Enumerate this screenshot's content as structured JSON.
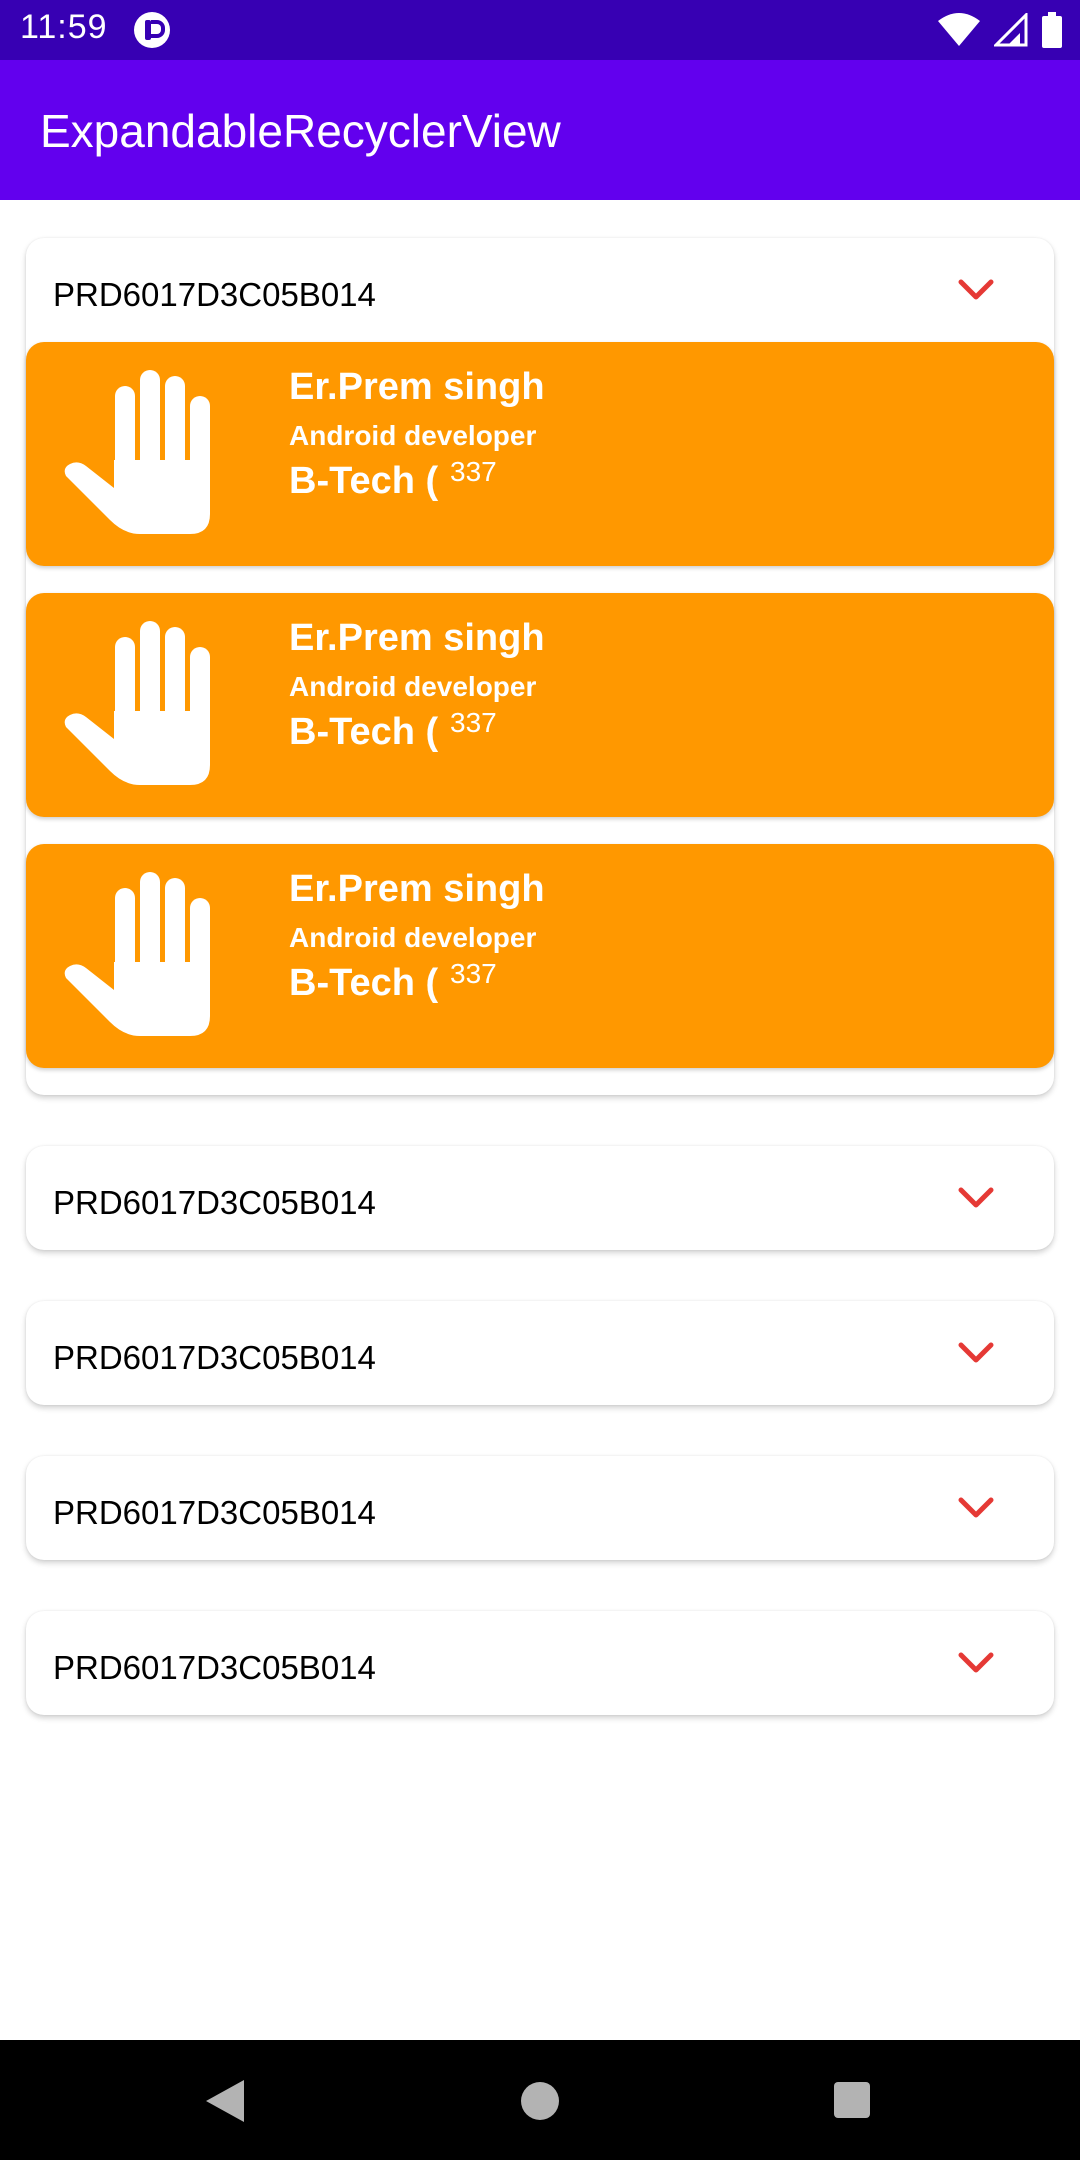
{
  "status_bar": {
    "time": "11:59",
    "icons": [
      "app-notification-icon",
      "wifi-icon",
      "signal-icon",
      "battery-icon"
    ]
  },
  "app_bar": {
    "title": "ExpandableRecyclerView"
  },
  "colors": {
    "status_bar": "#3700B3",
    "app_bar": "#6200EE",
    "child_card": "#FF9800",
    "chevron": "#E53935"
  },
  "groups": [
    {
      "title": "PRD6017D3C05B014",
      "expanded": true,
      "children": [
        {
          "icon": "hand-icon",
          "name": "Er.Prem singh",
          "role": "Android developer",
          "degree": "B-Tech (",
          "degree_sup": "337"
        },
        {
          "icon": "hand-icon",
          "name": "Er.Prem singh",
          "role": "Android developer",
          "degree": "B-Tech (",
          "degree_sup": "337"
        },
        {
          "icon": "hand-icon",
          "name": "Er.Prem singh",
          "role": "Android developer",
          "degree": "B-Tech (",
          "degree_sup": "337"
        }
      ]
    },
    {
      "title": "PRD6017D3C05B014",
      "expanded": false
    },
    {
      "title": "PRD6017D3C05B014",
      "expanded": false
    },
    {
      "title": "PRD6017D3C05B014",
      "expanded": false
    },
    {
      "title": "PRD6017D3C05B014",
      "expanded": false
    }
  ],
  "nav_bar": {
    "icons": [
      "back-icon",
      "home-icon",
      "recents-icon"
    ]
  }
}
